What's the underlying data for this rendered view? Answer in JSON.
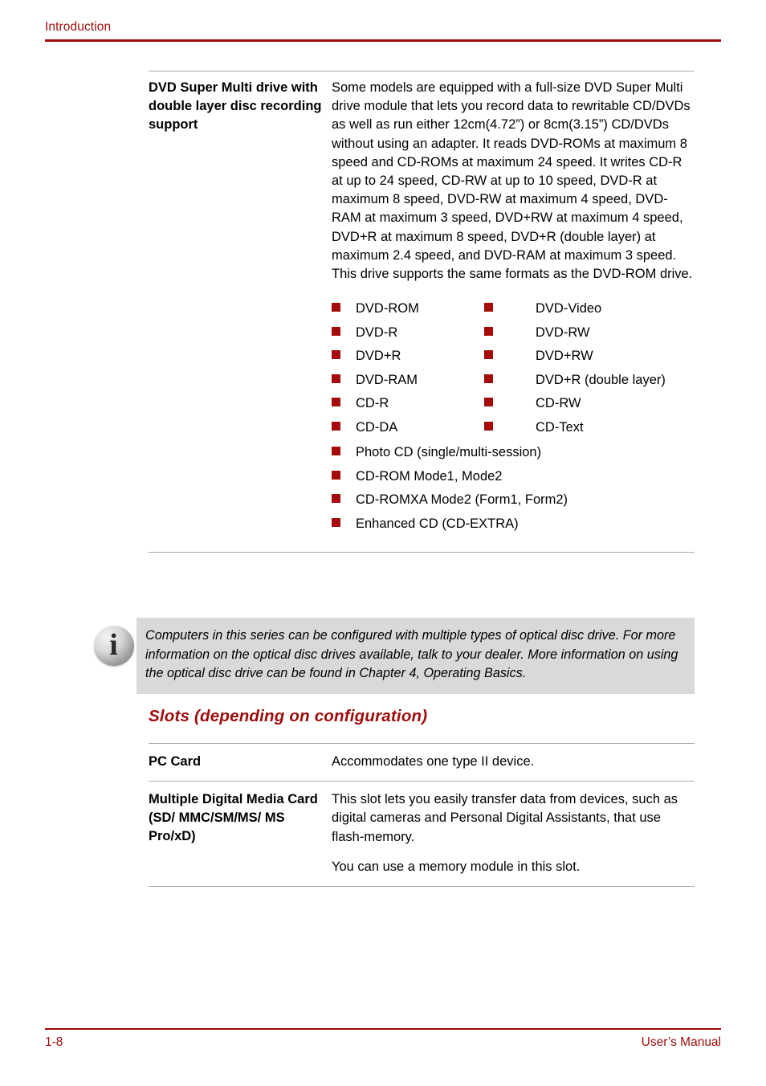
{
  "header": {
    "title": "Introduction"
  },
  "specs_optical": {
    "rows": [
      {
        "term": "DVD Super Multi drive with double layer disc recording support",
        "paragraphs": [
          "Some models are equipped with a full-size DVD Super Multi drive module that lets you record data to rewritable CD/DVDs as well as run either 12cm(4.72”) or 8cm(3.15”) CD/DVDs without using an adapter. It reads DVD-ROMs at maximum 8 speed and CD-ROMs at maximum 24 speed. It writes CD-R at up to 24 speed, CD-RW at up to 10 speed, DVD-R at maximum 8 speed, DVD-RW at maximum 4 speed, DVD-RAM at maximum 3 speed, DVD+RW at maximum 4 speed, DVD+R at maximum 8 speed, DVD+R (double layer) at maximum 2.4 speed, and DVD-RAM at maximum 3 speed. This drive supports the same formats as the DVD-ROM drive."
        ]
      }
    ]
  },
  "formats": {
    "two_column": [
      {
        "left": "DVD-ROM",
        "right": "DVD-Video"
      },
      {
        "left": "DVD-R",
        "right": "DVD-RW"
      },
      {
        "left": "DVD+R",
        "right": "DVD+RW"
      },
      {
        "left": "DVD-RAM",
        "right": "DVD+R (double layer)"
      },
      {
        "left": "CD-R",
        "right": "CD-RW"
      },
      {
        "left": "CD-DA",
        "right": "CD-Text"
      }
    ],
    "single_column": [
      "Photo CD (single/multi-session)",
      "CD-ROM Mode1, Mode2",
      "CD-ROMXA Mode2 (Form1, Form2)",
      "Enhanced CD (CD-EXTRA)"
    ]
  },
  "note": {
    "icon": "info-icon",
    "glyph": "i",
    "text": "Computers in this series can be configured with multiple types of optical disc drive. For more information on the optical disc drives available, talk to your dealer. More information on using the optical disc drive can be found in Chapter 4, Operating Basics."
  },
  "section": {
    "heading": "Slots (depending on configuration)"
  },
  "specs_slots": {
    "rows": [
      {
        "term": "PC Card",
        "paragraphs": [
          "Accommodates one type II device."
        ]
      },
      {
        "term": "Multiple Digital Media Card (SD/ MMC/SM/MS/ MS Pro/xD)",
        "paragraphs": [
          "This slot lets you easily transfer data from devices, such as digital cameras and Personal Digital Assistants, that use flash-memory.",
          "You can use a memory module in this slot."
        ]
      }
    ]
  },
  "footer": {
    "page_number": "1-8",
    "manual_label": "User’s Manual"
  },
  "colors": {
    "accent_red": "#9e0b0b",
    "bullet_red": "#a60b0b",
    "note_background": "#d9d9d9",
    "rule_gray": "#a9a9a9"
  }
}
